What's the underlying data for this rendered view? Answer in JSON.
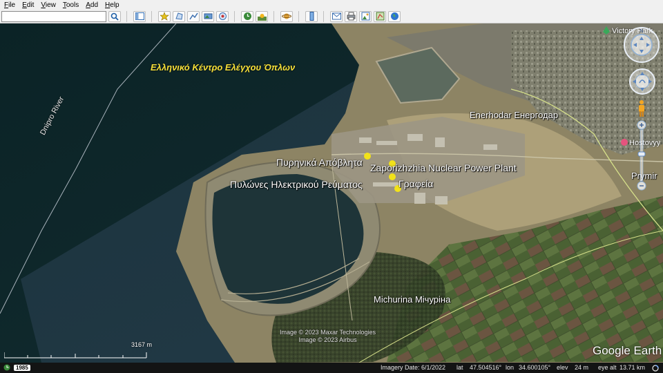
{
  "menu": [
    {
      "label": "File",
      "key": "F",
      "rest": "ile"
    },
    {
      "label": "Edit",
      "key": "E",
      "rest": "dit"
    },
    {
      "label": "View",
      "key": "V",
      "rest": "iew"
    },
    {
      "label": "Tools",
      "key": "T",
      "rest": "ools"
    },
    {
      "label": "Add",
      "key": "A",
      "rest": "dd"
    },
    {
      "label": "Help",
      "key": "H",
      "rest": "elp"
    }
  ],
  "search": {
    "value": "",
    "placeholder": ""
  },
  "toolbar_icons": [
    "search-icon",
    "sidebar-icon",
    "placemark-icon",
    "polygon-icon",
    "path-icon",
    "image-overlay-icon",
    "record-tour-icon",
    "historical-imagery-icon",
    "sunlight-icon",
    "planets-icon",
    "ruler-icon",
    "email-icon",
    "print-icon",
    "save-image-icon",
    "map-view-icon",
    "earth-icon"
  ],
  "map": {
    "labels": {
      "arms_center": "Ελληνικό Κέντρο Ελέγχου Όπλων",
      "river": "Dnipro River",
      "town_enerhodar": "Enerhodar Енергодар",
      "plant": "Zaporizhzhia Nuclear Power Plant",
      "nuclear_waste": "Πυρηνικά Απόβλητα",
      "power_pylons": "Πυλώνες Ηλεκτρικού Ρεύματος",
      "offices": "Γραφεία",
      "town_michurina": "Michurina Мічуріна",
      "victory_park": "Victory Park",
      "hostovyy": "Hostovyy",
      "prymir": "Prymir"
    },
    "copyright": [
      "Image © 2023 Maxar Technologies",
      "Image © 2023 Airbus"
    ],
    "logo": "Google Earth",
    "scale_label": "3167 m"
  },
  "status": {
    "year": "1985",
    "imagery_date": "Imagery Date: 6/1/2022",
    "lat_label": "lat",
    "lat": "47.504516°",
    "lon_label": "lon",
    "lon": "34.600105°",
    "elev_label": "elev",
    "elev": "24 m",
    "eye_label": "eye alt",
    "eye": "13.71 km"
  },
  "colors": {
    "water": "#10282b",
    "land_sand": "#a59a74",
    "field_green": "#4f6a3a",
    "label_yellow": "#f6e03a",
    "pin_yellow": "#f2e21a"
  }
}
